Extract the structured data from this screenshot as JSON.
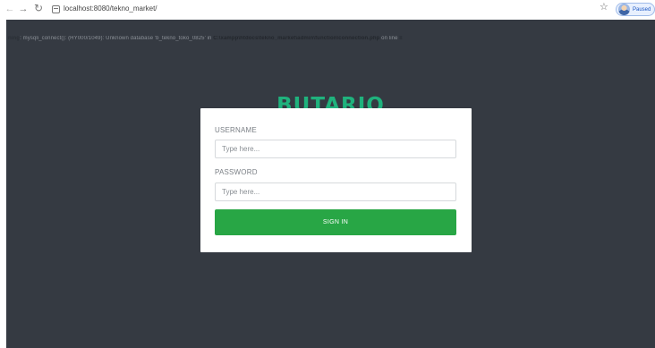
{
  "browser": {
    "url": "localhost:8080/tekno_market/",
    "profile_status": "Paused"
  },
  "error": {
    "prefix": "ning",
    "message": ": mysqli_connect(): (HY000/1049): Unknown database 'b_tekno_toko_0825' in ",
    "path": "C:\\xampp\\htdocs\\tekno_market\\admin\\function\\connection.php",
    "suffix": " on line ",
    "line": "8"
  },
  "brand": {
    "name": "BUTARJO",
    "color": "#1fb27d"
  },
  "login": {
    "username_label": "USERNAME",
    "username_placeholder": "Type here...",
    "username_value": "",
    "password_label": "PASSWORD",
    "password_placeholder": "Type here...",
    "password_value": "",
    "submit_label": "SIGN IN",
    "submit_color": "#28a645"
  },
  "colors": {
    "page_background": "#353a42",
    "card_background": "#ffffff"
  }
}
